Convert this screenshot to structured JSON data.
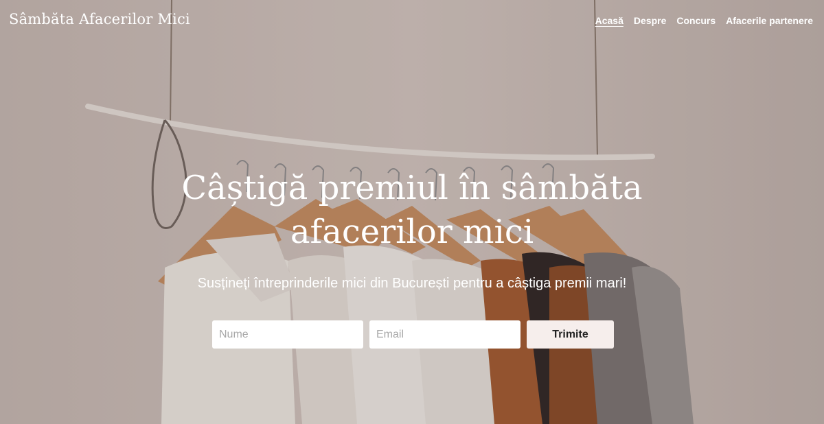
{
  "header": {
    "brand": "Sâmbăta Afacerilor Mici",
    "nav": [
      {
        "label": "Acasă",
        "active": true
      },
      {
        "label": "Despre",
        "active": false
      },
      {
        "label": "Concurs",
        "active": false
      },
      {
        "label": "Afacerile partenere",
        "active": false
      }
    ]
  },
  "hero": {
    "title_line1": "Câștigă premiul în sâmbăta",
    "title_line2": "afacerilor mici",
    "subtitle": "Susțineți întreprinderile mici din București pentru a câștiga premii mari!",
    "background_image": "clothes-rack-photo"
  },
  "form": {
    "name_placeholder": "Nume",
    "email_placeholder": "Email",
    "submit_label": "Trimite"
  },
  "colors": {
    "wall": "#cdbfba",
    "button_bg": "#f6eeec",
    "text": "#ffffff"
  }
}
